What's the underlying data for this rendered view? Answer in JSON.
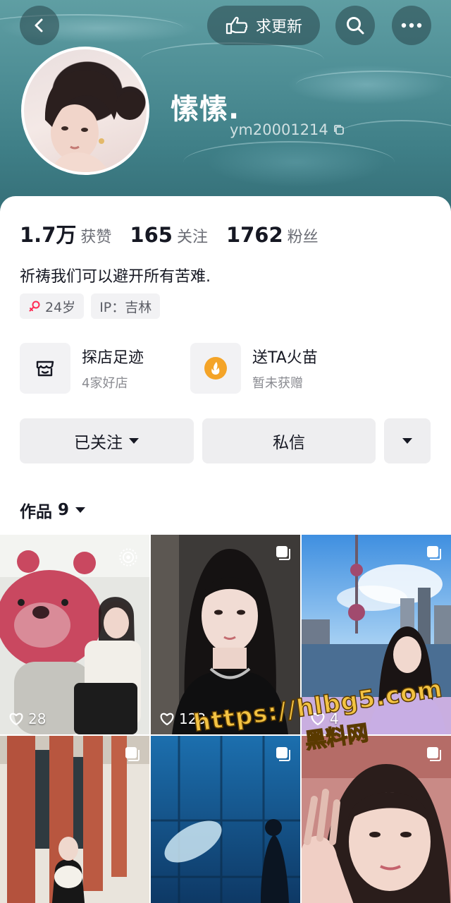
{
  "header": {
    "back_icon": "chevron-left-icon",
    "update_label": "求更新",
    "update_icon": "pointing-hand-icon",
    "search_icon": "search-icon",
    "more_icon": "more-dots-icon"
  },
  "profile": {
    "nickname": "愫愫.",
    "handle": "ym20001214",
    "copy_icon": "copy-icon"
  },
  "stats": [
    {
      "value": "1.7万",
      "label": "获赞"
    },
    {
      "value": "165",
      "label": "关注"
    },
    {
      "value": "1762",
      "label": "粉丝"
    }
  ],
  "bio": "祈祷我们可以避开所有苦难.",
  "tags": {
    "age": "24岁",
    "gender_icon": "female-icon",
    "ip": "IP：吉林"
  },
  "features": [
    {
      "title": "探店足迹",
      "subtitle": "4家好店",
      "icon": "shop-icon"
    },
    {
      "title": "送TA火苗",
      "subtitle": "暂未获赠",
      "icon": "flame-icon"
    }
  ],
  "actions": {
    "follow_label": "已关注",
    "message_label": "私信",
    "dropdown_icon": "caret-down-icon"
  },
  "works": {
    "label": "作品",
    "count": "9"
  },
  "grid": [
    {
      "likes": "28",
      "badge": "live-photo-icon"
    },
    {
      "likes": "123",
      "badge": "album-icon"
    },
    {
      "likes": "4",
      "badge": "album-icon"
    },
    {
      "likes": "",
      "badge": "album-icon"
    },
    {
      "likes": "",
      "badge": "album-icon"
    },
    {
      "likes": "",
      "badge": "album-icon"
    }
  ],
  "watermark": {
    "url": "https://hlbg5.com",
    "name": "黑料网"
  },
  "colors": {
    "accent_pink": "#fe2c55",
    "flame_orange": "#f4a428",
    "watermark_gold": "#f3c343"
  }
}
